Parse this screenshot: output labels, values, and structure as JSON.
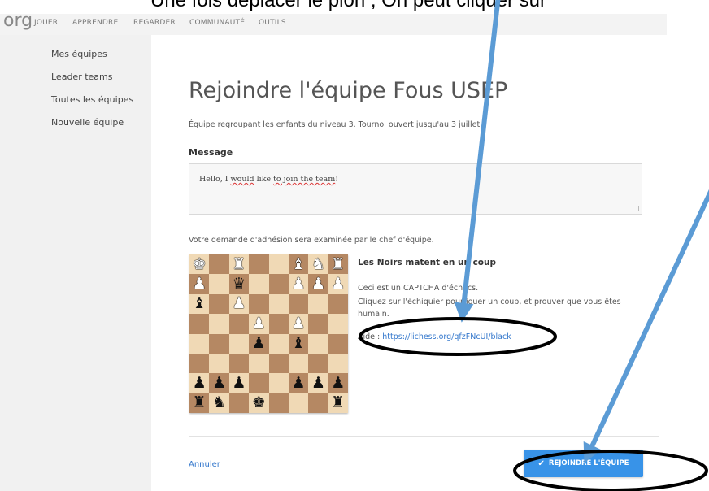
{
  "annotation_text": "Une fois déplacer le pion , On peut cliquer sur",
  "logo": "org",
  "nav": [
    "JOUER",
    "APPRENDRE",
    "REGARDER",
    "COMMUNAUTÉ",
    "OUTILS"
  ],
  "sidebar": [
    "Mes équipes",
    "Leader teams",
    "Toutes les équipes",
    "Nouvelle équipe"
  ],
  "title": "Rejoindre l'équipe Fous USEP",
  "description": "Équipe regroupant les enfants du niveau 3. Tournoi ouvert jusqu'au 3 juillet.",
  "message_label": "Message",
  "message": {
    "before": "Hello, I ",
    "squiggle1": "would",
    "middle": " like ",
    "squiggle2": "to join the team",
    "after": "!"
  },
  "review_note": "Votre demande d'adhésion sera examinée par le chef d'équipe.",
  "captcha": {
    "title": "Les Noirs matent en un coup",
    "line1": "Ceci est un CAPTCHA d'échecs.",
    "line2": "Cliquez sur l'échiquier pour jouer un coup, et prouver que vous êtes humain.",
    "help_label": "Aide :",
    "help_link": "https://lichess.org/qfzFNcUI/black"
  },
  "board": [
    [
      "wK",
      "",
      "wR",
      "",
      "",
      "wB",
      "wN",
      "wR"
    ],
    [
      "wP",
      "",
      "bQ",
      "",
      "",
      "wP",
      "wP",
      "wP"
    ],
    [
      "bB",
      "",
      "wP",
      "",
      "",
      "",
      "",
      ""
    ],
    [
      "",
      "",
      "",
      "wP",
      "",
      "wP",
      "",
      ""
    ],
    [
      "",
      "",
      "",
      "bP",
      "",
      "bB",
      "",
      ""
    ],
    [
      "",
      "",
      "",
      "",
      "",
      "",
      "",
      ""
    ],
    [
      "bP",
      "bP",
      "bP",
      "",
      "",
      "bP",
      "bP",
      "bP"
    ],
    [
      "bR",
      "bN",
      "",
      "bK",
      "",
      "",
      "",
      "bR"
    ]
  ],
  "cancel": "Annuler",
  "join_button": "REJOINDRE L'ÉQUIPE",
  "colors": {
    "arrow": "#5b9bd5",
    "ellipse": "#000000",
    "button": "#3893e8",
    "link": "#3377cc"
  }
}
